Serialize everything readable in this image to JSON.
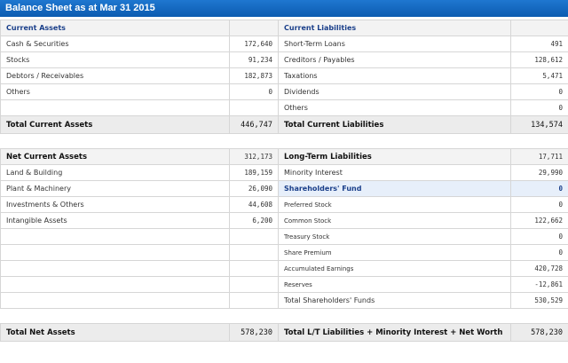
{
  "title": "Balance Sheet as at Mar 31 2015",
  "rows": {
    "h1": {
      "l": "Current Assets",
      "lv": "",
      "r": "Current Liabilities",
      "rv": ""
    },
    "r1": {
      "l": "Cash & Securities",
      "lv": "172,640",
      "r": "Short-Term Loans",
      "rv": "491"
    },
    "r2": {
      "l": "Stocks",
      "lv": "91,234",
      "r": "Creditors / Payables",
      "rv": "128,612"
    },
    "r3": {
      "l": "Debtors / Receivables",
      "lv": "182,873",
      "r": "Taxations",
      "rv": "5,471"
    },
    "r4": {
      "l": "Others",
      "lv": "0",
      "r": "Dividends",
      "rv": "0"
    },
    "r5": {
      "l": "",
      "lv": "",
      "r": "Others",
      "rv": "0"
    },
    "t1": {
      "l": "Total Current Assets",
      "lv": "446,747",
      "r": "Total Current Liabilities",
      "rv": "134,574"
    },
    "r6": {
      "l": "Net Current Assets",
      "lv": "312,173",
      "r": "Long-Term Liabilities",
      "rv": "17,711"
    },
    "r7": {
      "l": "Land & Building",
      "lv": "189,159",
      "r": "Minority Interest",
      "rv": "29,990"
    },
    "r8": {
      "l": "Plant & Machinery",
      "lv": "26,090",
      "r": "Shareholders' Fund",
      "rv": "0"
    },
    "r9": {
      "l": "Investments & Others",
      "lv": "44,608",
      "r": "Preferred Stock",
      "rv": "0"
    },
    "r10": {
      "l": "Intangible Assets",
      "lv": "6,200",
      "r": "Common Stock",
      "rv": "122,662"
    },
    "r11": {
      "l": "",
      "lv": "",
      "r": "Treasury Stock",
      "rv": "0"
    },
    "r12": {
      "l": "",
      "lv": "",
      "r": "Share Premium",
      "rv": "0"
    },
    "r13": {
      "l": "",
      "lv": "",
      "r": "Accumulated Earnings",
      "rv": "420,728"
    },
    "r14": {
      "l": "",
      "lv": "",
      "r": "Reserves",
      "rv": "-12,861"
    },
    "r15": {
      "l": "",
      "lv": "",
      "r": "Total Shareholders' Funds",
      "rv": "530,529"
    },
    "t2": {
      "l": "Total Net Assets",
      "lv": "578,230",
      "r": "Total L/T Liabilities + Minority Interest + Net Worth",
      "rv": "578,230"
    }
  }
}
